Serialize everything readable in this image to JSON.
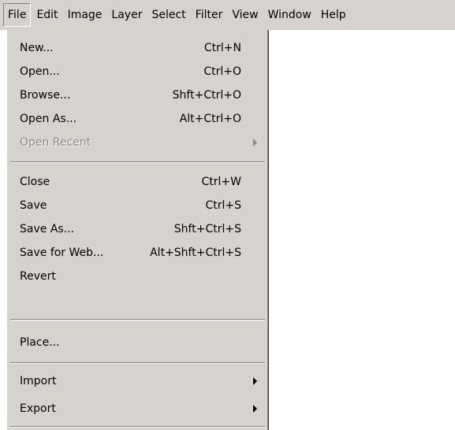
{
  "menubar": {
    "items": [
      {
        "label": "File"
      },
      {
        "label": "Edit"
      },
      {
        "label": "Image"
      },
      {
        "label": "Layer"
      },
      {
        "label": "Select"
      },
      {
        "label": "Filter"
      },
      {
        "label": "View"
      },
      {
        "label": "Window"
      },
      {
        "label": "Help"
      }
    ]
  },
  "file_menu": {
    "items": [
      {
        "label": "New...",
        "shortcut": "Ctrl+N"
      },
      {
        "label": "Open...",
        "shortcut": "Ctrl+O"
      },
      {
        "label": "Browse...",
        "shortcut": "Shft+Ctrl+O"
      },
      {
        "label": "Open As...",
        "shortcut": "Alt+Ctrl+O"
      },
      {
        "label": "Open Recent",
        "shortcut": "",
        "disabled": true,
        "submenu": true
      },
      {
        "label": "Close",
        "shortcut": "Ctrl+W"
      },
      {
        "label": "Save",
        "shortcut": "Ctrl+S"
      },
      {
        "label": "Save As...",
        "shortcut": "Shft+Ctrl+S"
      },
      {
        "label": "Save for Web...",
        "shortcut": "Alt+Shft+Ctrl+S"
      },
      {
        "label": "Revert",
        "shortcut": ""
      },
      {
        "label": "Place...",
        "shortcut": ""
      },
      {
        "label": "Import",
        "shortcut": "",
        "submenu": true
      },
      {
        "label": "Export",
        "shortcut": "",
        "submenu": true
      }
    ]
  },
  "colors": {
    "menu_background": "#d6d3ce",
    "disabled_text": "#8a8a8a",
    "page_background": "#ffffff"
  },
  "icons": {
    "submenu": "submenu-arrow-icon"
  }
}
